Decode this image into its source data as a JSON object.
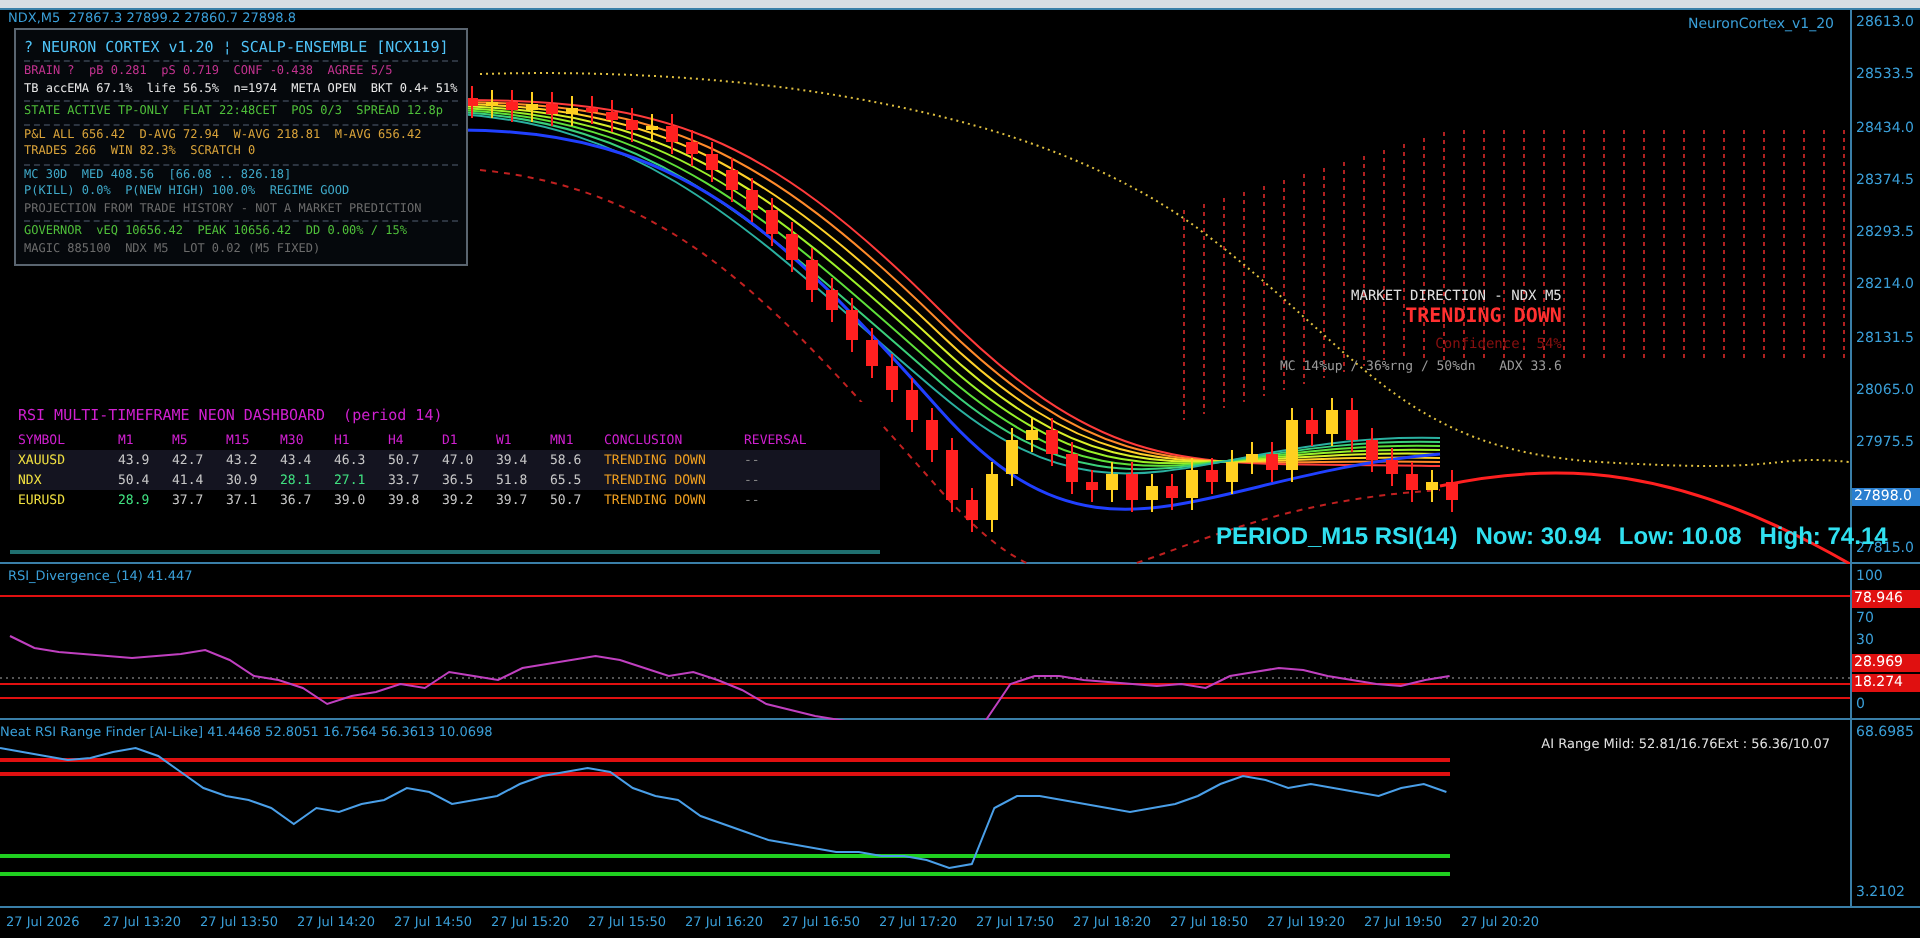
{
  "chart_header": {
    "symbol": "NDX,M5  27867.3 27899.2 27860.7 27898.8",
    "indicator": "NeuronCortex_v1_20"
  },
  "price_axis": [
    {
      "label": "28613.0",
      "kind": "tick"
    },
    {
      "label": "28533.5",
      "kind": "tick"
    },
    {
      "label": "28434.0",
      "kind": "tick"
    },
    {
      "label": "28374.5",
      "kind": "tick"
    },
    {
      "label": "28293.5",
      "kind": "tick"
    },
    {
      "label": "28214.0",
      "kind": "tick"
    },
    {
      "label": "28131.5",
      "kind": "tick"
    },
    {
      "label": "28065.0",
      "kind": "tick"
    },
    {
      "label": "27975.5",
      "kind": "tick"
    },
    {
      "label": "27898.0",
      "kind": "current"
    },
    {
      "label": "27815.0",
      "kind": "tick"
    }
  ],
  "cortex_panel": {
    "title": "? NEURON CORTEX v1.20 ¦ SCALP-ENSEMBLE [NCX119]",
    "sections": [
      [
        {
          "text": "BRAIN ?  pB 0.281  pS 0.719  CONF -0.438  AGREE 5/5",
          "color": "#c2338f"
        },
        {
          "text": "TB accEMA 67.1%  life 56.5%  n=1974  META OPEN  BKT 0.4+ 51%",
          "color": "#e8e8e8"
        }
      ],
      [
        {
          "text": "STATE ACTIVE TP-ONLY  FLAT 22:48CET  POS 0/3  SPREAD 12.8p",
          "color": "#4fbf3a"
        }
      ],
      [
        {
          "text": "P&L ALL 656.42  D-AVG 72.94  W-AVG 218.81  M-AVG 656.42",
          "color": "#d9a33a"
        },
        {
          "text": "TRADES 266  WIN 82.3%  SCRATCH 0",
          "color": "#d9a33a"
        }
      ],
      [
        {
          "text": "MC 30D  MED 408.56  [66.08 .. 826.18]",
          "color": "#3fa9c9"
        },
        {
          "text": "P(KILL) 0.0%  P(NEW HIGH) 100.0%  REGIME GOOD",
          "color": "#3fa9c9"
        },
        {
          "text": "PROJECTION FROM TRADE HISTORY - NOT A MARKET PREDICTION",
          "color": "#6b6b6b"
        }
      ],
      [
        {
          "text": "GOVERNOR  vEQ 10656.42  PEAK 10656.42  DD 0.00% / 15%",
          "color": "#4fbf3a"
        },
        {
          "text": "MAGIC 885100  NDX M5  LOT 0.02 (M5 FIXED)",
          "color": "#6b6b6b"
        }
      ]
    ]
  },
  "rsi_dashboard": {
    "title": "RSI MULTI-TIMEFRAME NEON DASHBOARD  (period 14)",
    "columns": [
      "SYMBOL",
      "M1",
      "M5",
      "M15",
      "M30",
      "H1",
      "H4",
      "D1",
      "W1",
      "MN1",
      "CONCLUSION",
      "REVERSAL"
    ],
    "rows": [
      {
        "symbol": "XAUUSD",
        "values": [
          {
            "text": "43.9",
            "oversold": false
          },
          {
            "text": "42.7",
            "oversold": false
          },
          {
            "text": "43.2",
            "oversold": false
          },
          {
            "text": "43.4",
            "oversold": false
          },
          {
            "text": "46.3",
            "oversold": false
          },
          {
            "text": "50.7",
            "oversold": false
          },
          {
            "text": "47.0",
            "oversold": false
          },
          {
            "text": "39.4",
            "oversold": false
          },
          {
            "text": "58.6",
            "oversold": false
          }
        ],
        "conclusion": "TRENDING DOWN",
        "reversal": "--"
      },
      {
        "symbol": "NDX",
        "values": [
          {
            "text": "50.4",
            "oversold": false
          },
          {
            "text": "41.4",
            "oversold": false
          },
          {
            "text": "30.9",
            "oversold": false
          },
          {
            "text": "28.1",
            "oversold": true
          },
          {
            "text": "27.1",
            "oversold": true
          },
          {
            "text": "33.7",
            "oversold": false
          },
          {
            "text": "36.5",
            "oversold": false
          },
          {
            "text": "51.8",
            "oversold": false
          },
          {
            "text": "65.5",
            "oversold": false
          }
        ],
        "conclusion": "TRENDING DOWN",
        "reversal": "--"
      },
      {
        "symbol": "EURUSD",
        "values": [
          {
            "text": "28.9",
            "oversold": true
          },
          {
            "text": "37.7",
            "oversold": false
          },
          {
            "text": "37.1",
            "oversold": false
          },
          {
            "text": "36.7",
            "oversold": false
          },
          {
            "text": "39.0",
            "oversold": false
          },
          {
            "text": "39.8",
            "oversold": false
          },
          {
            "text": "39.2",
            "oversold": false
          },
          {
            "text": "39.7",
            "oversold": false
          },
          {
            "text": "50.7",
            "oversold": false
          }
        ],
        "conclusion": "TRENDING DOWN",
        "reversal": "--"
      }
    ]
  },
  "market_direction": {
    "title": "MARKET DIRECTION - NDX M5",
    "trend": "TRENDING DOWN",
    "confidence": "Confidence: 54%",
    "stats": "MC 14%up / 36%rng / 50%dn   ADX 33.6"
  },
  "rsi_readout": {
    "period": "PERIOD_M15 RSI(14)",
    "now": "Now: 30.94",
    "low": "Low: 10.08",
    "high": "High: 74.14"
  },
  "divergence_window": {
    "title": "RSI_Divergence_(14) 41.447",
    "axis": [
      {
        "label": "100",
        "kind": "tick"
      },
      {
        "label": "78.946",
        "kind": "level"
      },
      {
        "label": "70",
        "kind": "tick"
      },
      {
        "label": "30",
        "kind": "tick"
      },
      {
        "label": "28.969",
        "kind": "level"
      },
      {
        "label": "18.274",
        "kind": "level"
      },
      {
        "label": "0",
        "kind": "tick"
      }
    ]
  },
  "range_window": {
    "title": "Neat RSI Range Finder [AI-Like] 41.4468 52.8051 16.7564 56.3613 10.0698",
    "summary": "AI Range Mild: 52.81/16.76Ext : 56.36/10.07",
    "axis": [
      {
        "label": "68.6985",
        "kind": "tick"
      },
      {
        "label": "3.2102",
        "kind": "tick"
      }
    ]
  },
  "time_axis": [
    "27 Jul 2026",
    "27 Jul 13:20",
    "27 Jul 13:50",
    "27 Jul 14:20",
    "27 Jul 14:50",
    "27 Jul 15:20",
    "27 Jul 15:50",
    "27 Jul 16:20",
    "27 Jul 16:50",
    "27 Jul 17:20",
    "27 Jul 17:50",
    "27 Jul 18:20",
    "27 Jul 18:50",
    "27 Jul 19:20",
    "27 Jul 19:50",
    "27 Jul 20:20"
  ]
}
